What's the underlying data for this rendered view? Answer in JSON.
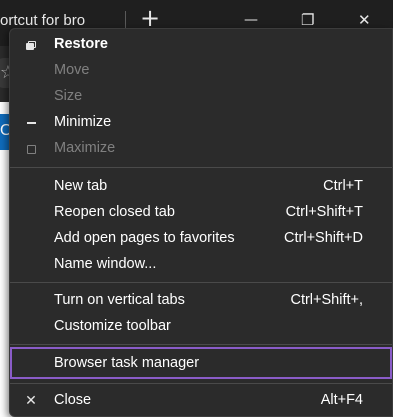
{
  "browser": {
    "tab_title": "ortcut for bro",
    "new_tab_glyph": "+",
    "minimize_glyph": "—",
    "restore_glyph": "❐",
    "close_glyph": "✕",
    "star_glyph": "☆",
    "page_fragment": "O"
  },
  "menu": {
    "system_items": [
      {
        "label": "Restore",
        "icon": "restore-icon",
        "enabled": true,
        "bold": true
      },
      {
        "label": "Move",
        "icon": "",
        "enabled": false
      },
      {
        "label": "Size",
        "icon": "",
        "enabled": false
      },
      {
        "label": "Minimize",
        "icon": "minimize-icon",
        "enabled": true
      },
      {
        "label": "Maximize",
        "icon": "maximize-icon",
        "enabled": false
      }
    ],
    "tab_items": [
      {
        "label": "New tab",
        "shortcut": "Ctrl+T"
      },
      {
        "label": "Reopen closed tab",
        "shortcut": "Ctrl+Shift+T"
      },
      {
        "label": "Add open pages to favorites",
        "shortcut": "Ctrl+Shift+D"
      },
      {
        "label": "Name window...",
        "shortcut": ""
      }
    ],
    "toolbar_items": [
      {
        "label": "Turn on vertical tabs",
        "shortcut": "Ctrl+Shift+,"
      },
      {
        "label": "Customize toolbar",
        "shortcut": ""
      }
    ],
    "task_manager": {
      "label": "Browser task manager",
      "highlighted": true
    },
    "close": {
      "label": "Close",
      "shortcut": "Alt+F4",
      "icon": "close-icon",
      "glyph": "✕"
    }
  },
  "colors": {
    "menu_bg": "#2b2b2b",
    "highlight_border": "#8a5cc8",
    "disabled_text": "#808080"
  }
}
